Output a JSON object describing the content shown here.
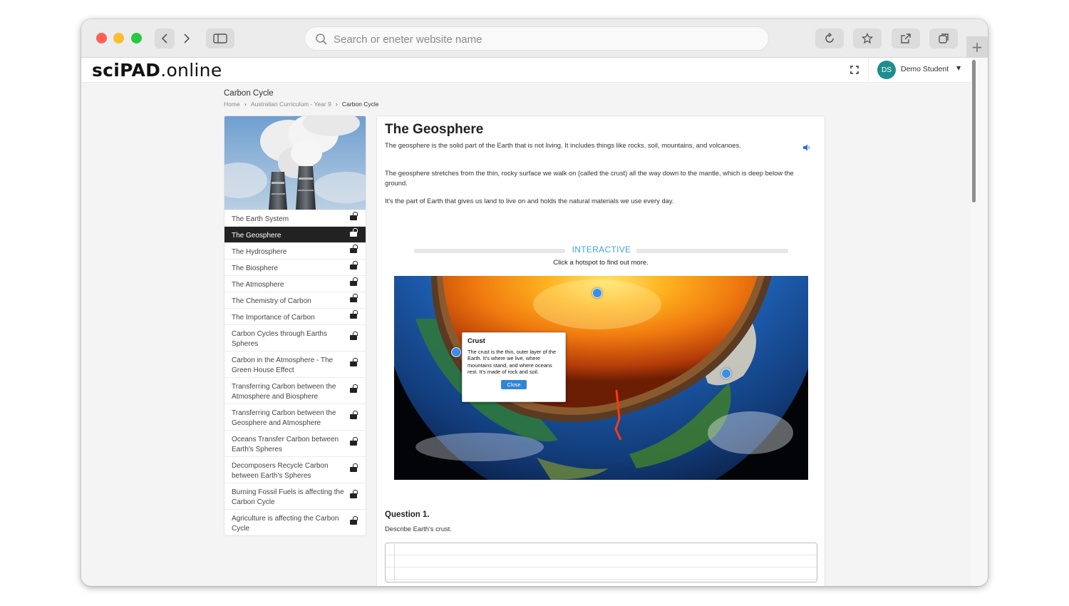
{
  "browser": {
    "url_placeholder": "Search or eneter website name"
  },
  "header": {
    "logo_bold": "sciPAD",
    "logo_light": ".online",
    "user_initials": "DS",
    "user_name": "Demo Student"
  },
  "page": {
    "title": "Carbon Cycle",
    "breadcrumb": [
      "Home",
      "Australian Curriculum - Year 9",
      "Carbon Cycle"
    ]
  },
  "menu": {
    "items": [
      {
        "label": "The Earth System"
      },
      {
        "label": "The Geosphere",
        "active": true
      },
      {
        "label": "The Hydrosphere"
      },
      {
        "label": "The Biosphere"
      },
      {
        "label": "The Atmosphere"
      },
      {
        "label": "The Chemistry of Carbon"
      },
      {
        "label": "The Importance of Carbon"
      },
      {
        "label": "Carbon Cycles through Earths Spheres"
      },
      {
        "label": "Carbon in the Atmosphere - The Green House Effect"
      },
      {
        "label": "Transferring Carbon between the Atmosphere and Biosphere"
      },
      {
        "label": "Transferring Carbon between the Geosphere and Atmosphere"
      },
      {
        "label": "Oceans Transfer Carbon between Earth's Spheres"
      },
      {
        "label": "Decomposers Recycle Carbon between Earth's Spheres"
      },
      {
        "label": "Burning Fossil Fuels is affecting the Carbon Cycle"
      },
      {
        "label": "Agriculture is affecting the Carbon Cycle"
      }
    ]
  },
  "content": {
    "title": "The Geosphere",
    "paragraphs": [
      "The geosphere is the solid part of the Earth that is not living. It includes things like rocks, soil, mountains, and volcanoes.",
      "The geosphere stretches from the thin, rocky surface we walk on (called the crust) all the way down to the mantle, which is deep below the ground.",
      "It's the part of Earth that gives us land to live on and holds the natural materials we use every day."
    ],
    "interactive": {
      "label": "INTERACTIVE",
      "instruction": "Click a hotspot to find out more.",
      "popup": {
        "title": "Crust",
        "text": "The crust is the thin, outer layer of the Earth. It's where we live, where mountains stand, and where oceans rest. It's made of rock and soil.",
        "close_label": "Close"
      }
    },
    "question": {
      "title": "Question 1.",
      "text": "Describe Earth's crust.",
      "answer": ""
    }
  },
  "colors": {
    "accent": "#3fa4de",
    "avatar": "#1f8e8e",
    "active_menu": "#222222",
    "hotspot": "#3a8ee6"
  },
  "icons": [
    "search-icon",
    "back-icon",
    "forward-icon",
    "sidebar-icon",
    "reload-icon",
    "star-icon",
    "share-icon",
    "tabs-icon",
    "plus-icon",
    "fullscreen-icon",
    "chevron-down-icon",
    "lock-icon",
    "speaker-icon"
  ]
}
